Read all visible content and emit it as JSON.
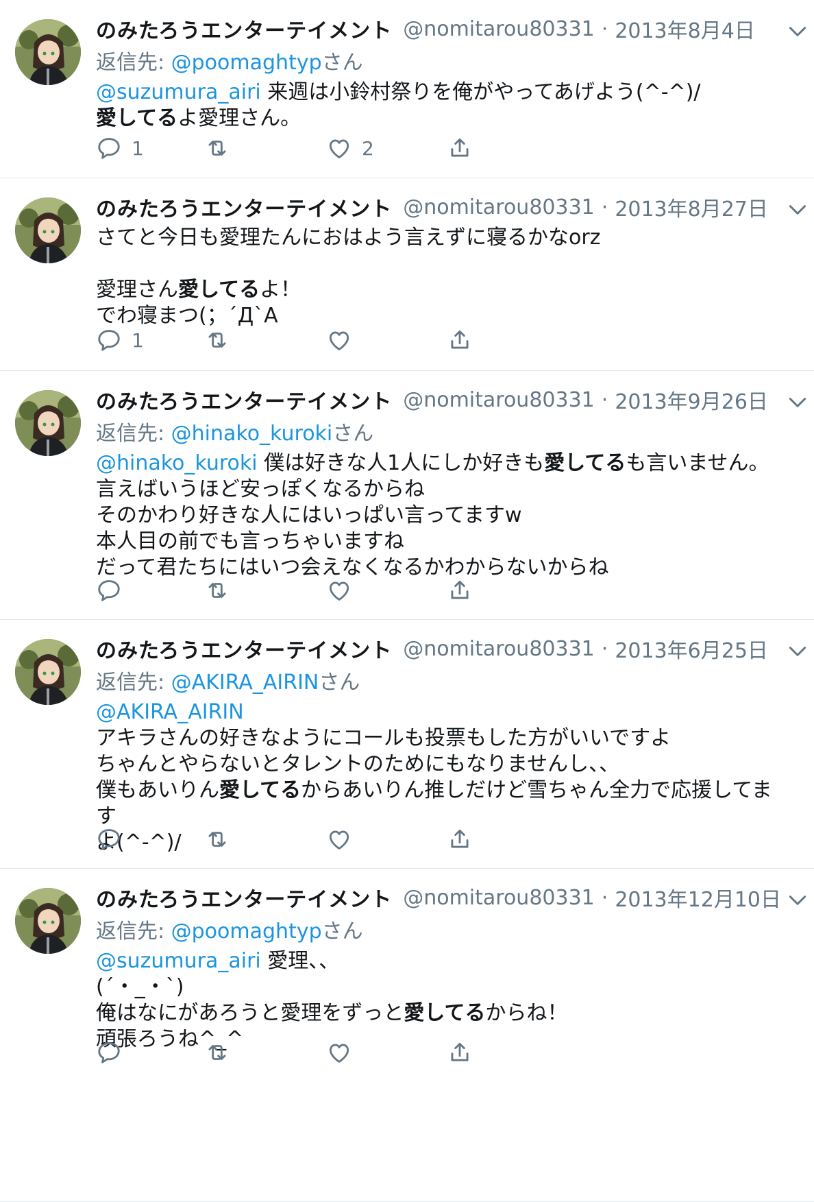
{
  "tweets": [
    {
      "name": "のみたろうエンターテイメント",
      "handle": "@nomitarou80331",
      "sep": "·",
      "date": "2013年8月4日",
      "reply_label": "返信先: ",
      "reply_to": "@poomaghtyp",
      "reply_suffix": "さん",
      "mention": "@suzumura_airi",
      "text_lines": [
        {
          "pre": " 来週は小鈴村祭りを俺がやってあげよう(^-^)/",
          "bold": "",
          "post": ""
        },
        {
          "pre": "",
          "bold": "愛してる",
          "post": "よ愛理さん。"
        }
      ],
      "reply_count": "1",
      "retweet_count": "",
      "like_count": "2"
    },
    {
      "name": "のみたろうエンターテイメント",
      "handle": "@nomitarou80331",
      "sep": "·",
      "date": "2013年8月27日",
      "reply_label": "",
      "reply_to": "",
      "reply_suffix": "",
      "mention": "",
      "text_lines": [
        {
          "pre": "さてと今日も愛理たんにおはよう言えずに寝るかなorz",
          "bold": "",
          "post": ""
        },
        {
          "pre": " ",
          "bold": "",
          "post": ""
        },
        {
          "pre": "愛理さん",
          "bold": "愛してる",
          "post": "よ！"
        },
        {
          "pre": "でわ寝まつ(；´Д`A",
          "bold": "",
          "post": ""
        }
      ],
      "reply_count": "1",
      "retweet_count": "",
      "like_count": ""
    },
    {
      "name": "のみたろうエンターテイメント",
      "handle": "@nomitarou80331",
      "sep": "·",
      "date": "2013年9月26日",
      "reply_label": "返信先: ",
      "reply_to": "@hinako_kuroki",
      "reply_suffix": "さん",
      "mention": "@hinako_kuroki",
      "text_lines": [
        {
          "pre": " 僕は好きな人1人にしか好きも",
          "bold": "愛してる",
          "post": "も言いません。"
        },
        {
          "pre": "言えばいうほど安っぽくなるからね",
          "bold": "",
          "post": ""
        },
        {
          "pre": "そのかわり好きな人にはいっぱい言ってますw",
          "bold": "",
          "post": ""
        },
        {
          "pre": "本人目の前でも言っちゃいますね",
          "bold": "",
          "post": ""
        },
        {
          "pre": "だって君たちにはいつ会えなくなるかわからないからね",
          "bold": "",
          "post": ""
        }
      ],
      "reply_count": "",
      "retweet_count": "",
      "like_count": ""
    },
    {
      "name": "のみたろうエンターテイメント",
      "handle": "@nomitarou80331",
      "sep": "·",
      "date": "2013年6月25日",
      "reply_label": "返信先: ",
      "reply_to": "@AKIRA_AIRIN",
      "reply_suffix": "さん",
      "mention": "@AKIRA_AIRIN",
      "text_lines": [
        {
          "pre": "",
          "bold": "",
          "post": ""
        },
        {
          "pre": "アキラさんの好きなようにコールも投票もした方がいいですよ",
          "bold": "",
          "post": ""
        },
        {
          "pre": "ちゃんとやらないとタレントのためにもなりませんし、、",
          "bold": "",
          "post": ""
        },
        {
          "pre": "僕もあいりん",
          "bold": "愛してる",
          "post": "からあいりん推しだけど雪ちゃん全力で応援してます"
        },
        {
          "pre": "よ(^-^)/",
          "bold": "",
          "post": ""
        }
      ],
      "reply_count": "",
      "retweet_count": "",
      "like_count": ""
    },
    {
      "name": "のみたろうエンターテイメント",
      "handle": "@nomitarou80331",
      "sep": "·",
      "date": "2013年12月10日",
      "reply_label": "返信先: ",
      "reply_to": "@poomaghtyp",
      "reply_suffix": "さん",
      "mention": "@suzumura_airi",
      "text_lines": [
        {
          "pre": " 愛理、、",
          "bold": "",
          "post": ""
        },
        {
          "pre": "(´・_・`)",
          "bold": "",
          "post": ""
        },
        {
          "pre": "俺はなにがあろうと愛理をずっと",
          "bold": "愛してる",
          "post": "からね！"
        },
        {
          "pre": "頑張ろうね^_^",
          "bold": "",
          "post": ""
        }
      ],
      "reply_count": "",
      "retweet_count": "",
      "like_count": ""
    }
  ],
  "colors": {
    "link": "#1b95e0",
    "muted": "#657786",
    "text": "#14171a",
    "border": "#e1e8ed"
  },
  "icons": {
    "reply": "reply-icon",
    "retweet": "retweet-icon",
    "like": "heart-icon",
    "share": "share-icon",
    "caret": "chevron-down-icon"
  }
}
